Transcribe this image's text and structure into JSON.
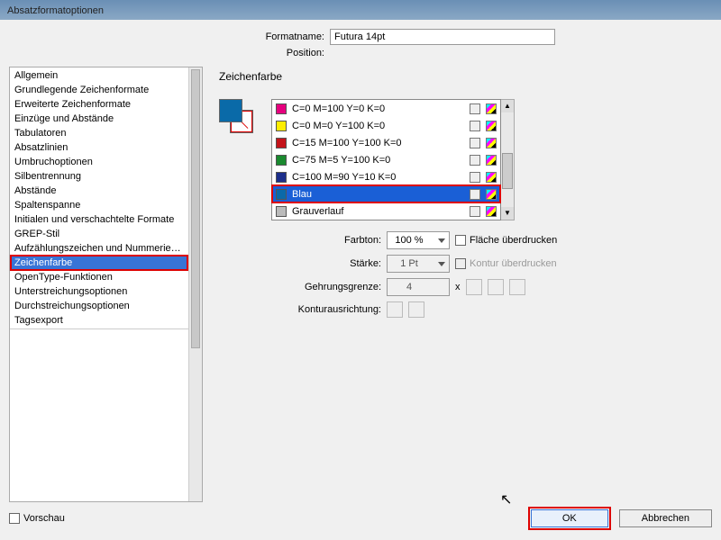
{
  "window": {
    "title": "Absatzformatoptionen"
  },
  "topform": {
    "formatname_label": "Formatname:",
    "formatname_value": "Futura 14pt",
    "position_label": "Position:"
  },
  "sidebar": {
    "items": [
      "Allgemein",
      "Grundlegende Zeichenformate",
      "Erweiterte Zeichenformate",
      "Einzüge und Abstände",
      "Tabulatoren",
      "Absatzlinien",
      "Umbruchoptionen",
      "Silbentrennung",
      "Abstände",
      "Spaltenspanne",
      "Initialen und verschachtelte Formate",
      "GREP-Stil",
      "Aufzählungszeichen und Nummerierung",
      "Zeichenfarbe",
      "OpenType-Funktionen",
      "Unterstreichungsoptionen",
      "Durchstreichungsoptionen",
      "Tagsexport"
    ],
    "selected_index": 13
  },
  "section": {
    "title": "Zeichenfarbe"
  },
  "swatches": [
    {
      "name": "C=0 M=100 Y=0 K=0",
      "hex": "#e6007e"
    },
    {
      "name": "C=0 M=0 Y=100 K=0",
      "hex": "#ffed00"
    },
    {
      "name": "C=15 M=100 Y=100 K=0",
      "hex": "#c4141b"
    },
    {
      "name": "C=75 M=5 Y=100 K=0",
      "hex": "#1a8a2f"
    },
    {
      "name": "C=100 M=90 Y=10 K=0",
      "hex": "#1d2f8b"
    },
    {
      "name": "Blau",
      "hex": "#0b69a8"
    },
    {
      "name": "Grauverlauf",
      "hex": "#bbbbbb"
    }
  ],
  "swatch_selected_index": 5,
  "controls": {
    "tint_label": "Farbton:",
    "tint_value": "100 %",
    "stroke_label": "Stärke:",
    "stroke_value": "1 Pt",
    "miter_label": "Gehrungsgrenze:",
    "miter_value": "4",
    "miter_suffix": "x",
    "align_label": "Konturausrichtung:",
    "overprint_fill": "Fläche überdrucken",
    "overprint_stroke": "Kontur überdrucken"
  },
  "footer": {
    "preview": "Vorschau",
    "ok": "OK",
    "cancel": "Abbrechen"
  }
}
